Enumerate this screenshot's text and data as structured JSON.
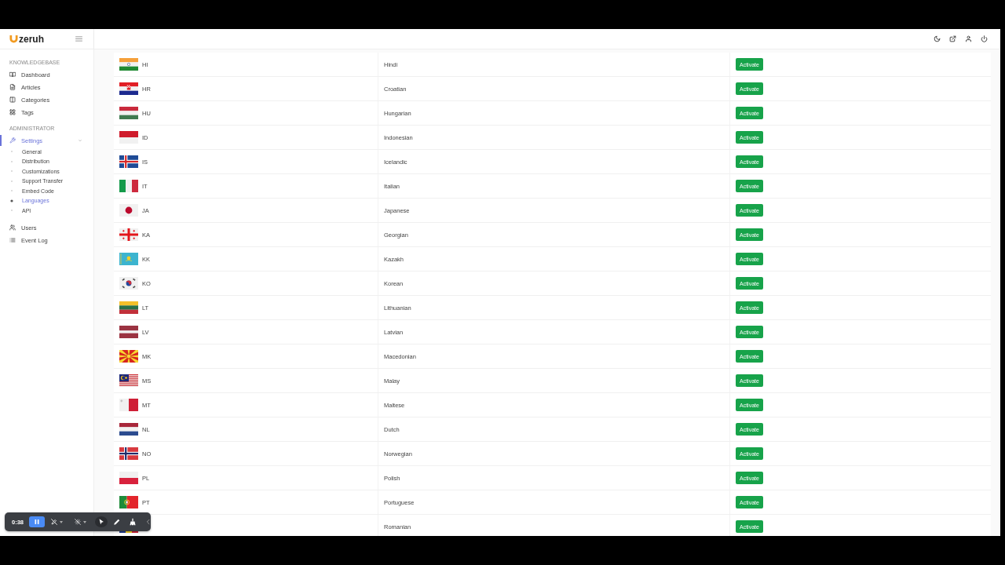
{
  "brand": {
    "name": "zeruh"
  },
  "sidebar": {
    "sections": [
      {
        "title": "KNOWLEDGEBASE",
        "items": [
          {
            "label": "Dashboard",
            "kind": "book",
            "selected": false
          },
          {
            "label": "Articles",
            "kind": "file",
            "selected": false
          },
          {
            "label": "Categories",
            "kind": "columns",
            "selected": false
          },
          {
            "label": "Tags",
            "kind": "grid",
            "selected": false
          }
        ]
      },
      {
        "title": "ADMINISTRATOR",
        "items": [
          {
            "label": "Settings",
            "kind": "wrench",
            "selected": true,
            "expanded": true,
            "children": [
              {
                "label": "General",
                "selected": false
              },
              {
                "label": "Distribution",
                "selected": false
              },
              {
                "label": "Customizations",
                "selected": false
              },
              {
                "label": "Support Transfer",
                "selected": false
              },
              {
                "label": "Embed Code",
                "selected": false
              },
              {
                "label": "Languages",
                "selected": true
              },
              {
                "label": "API",
                "selected": false
              }
            ]
          },
          {
            "label": "Users",
            "kind": "users",
            "selected": false
          },
          {
            "label": "Event Log",
            "kind": "list",
            "selected": false
          }
        ]
      }
    ]
  },
  "languages": {
    "rows": [
      {
        "kind": "india",
        "code": "HI",
        "name": "Hindi",
        "action": "Activate"
      },
      {
        "kind": "croatia",
        "code": "HR",
        "name": "Croatian",
        "action": "Activate"
      },
      {
        "kind": "hungary",
        "code": "HU",
        "name": "Hungarian",
        "action": "Activate"
      },
      {
        "kind": "indonesia",
        "code": "ID",
        "name": "Indonesian",
        "action": "Activate"
      },
      {
        "kind": "iceland",
        "code": "IS",
        "name": "Icelandic",
        "action": "Activate"
      },
      {
        "kind": "italy",
        "code": "IT",
        "name": "Italian",
        "action": "Activate"
      },
      {
        "kind": "japan",
        "code": "JA",
        "name": "Japanese",
        "action": "Activate"
      },
      {
        "kind": "georgia",
        "code": "KA",
        "name": "Georgian",
        "action": "Activate"
      },
      {
        "kind": "kazakhstan",
        "code": "KK",
        "name": "Kazakh",
        "action": "Activate"
      },
      {
        "kind": "korea",
        "code": "KO",
        "name": "Korean",
        "action": "Activate"
      },
      {
        "kind": "lithuania",
        "code": "LT",
        "name": "Lithuanian",
        "action": "Activate"
      },
      {
        "kind": "latvia",
        "code": "LV",
        "name": "Latvian",
        "action": "Activate"
      },
      {
        "kind": "macedonia",
        "code": "MK",
        "name": "Macedonian",
        "action": "Activate"
      },
      {
        "kind": "malaysia",
        "code": "MS",
        "name": "Malay",
        "action": "Activate"
      },
      {
        "kind": "malta",
        "code": "MT",
        "name": "Maltese",
        "action": "Activate"
      },
      {
        "kind": "netherlands",
        "code": "NL",
        "name": "Dutch",
        "action": "Activate"
      },
      {
        "kind": "norway",
        "code": "NO",
        "name": "Norwegian",
        "action": "Activate"
      },
      {
        "kind": "poland",
        "code": "PL",
        "name": "Polish",
        "action": "Activate"
      },
      {
        "kind": "portugal",
        "code": "PT",
        "name": "Portuguese",
        "action": "Activate"
      },
      {
        "kind": "romania",
        "name": "Romanian",
        "action": "Activate"
      }
    ]
  },
  "recorder": {
    "time": "0:38",
    "tools": [
      {
        "kind": "pause",
        "selected": true
      },
      {
        "kind": "annotate",
        "selected": false,
        "menu": true
      },
      {
        "kind": "laser",
        "selected": false,
        "menu": true
      },
      {
        "kind": "pointer",
        "selected": true
      },
      {
        "kind": "pencil",
        "selected": false
      },
      {
        "kind": "broom",
        "selected": false
      },
      {
        "kind": "collapse",
        "selected": false
      }
    ]
  }
}
